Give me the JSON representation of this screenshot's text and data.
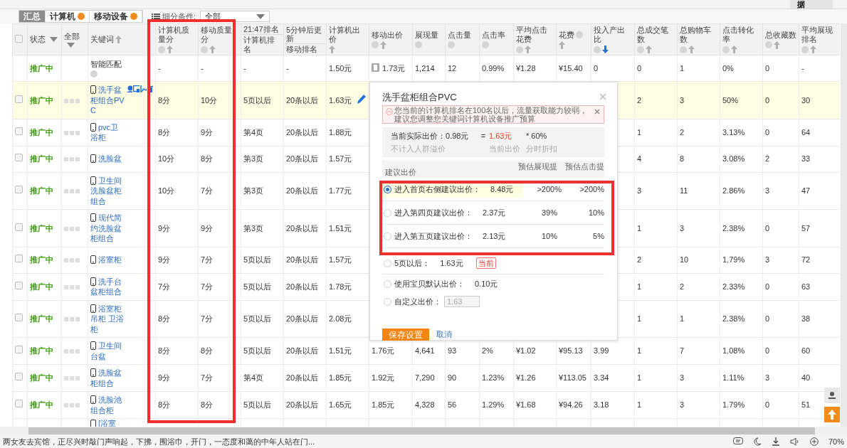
{
  "top_button": "据",
  "view_tabs": [
    {
      "label": "汇总",
      "selected": true,
      "help": false
    },
    {
      "label": "计算机",
      "selected": false,
      "help": true
    },
    {
      "label": "移动设备",
      "selected": false,
      "help": true
    }
  ],
  "filter": {
    "label": "细分条件:",
    "value": "全部"
  },
  "table": {
    "select_all": {
      "checked": false
    },
    "columns": [
      {
        "label": "状态",
        "filter": true
      },
      {
        "label": "全部",
        "filter": true
      },
      {
        "label": "关键词",
        "sortable": true,
        "sort_active": false
      },
      {
        "label": "计算机质量分",
        "help": true,
        "sortable": true,
        "sort_active": false
      },
      {
        "label": "移动质量分",
        "help": true,
        "sortable": true,
        "sort_active": false
      },
      {
        "top": "21:47排名",
        "label": "计算机排名"
      },
      {
        "top": "5分钟后更新",
        "label": "移动排名"
      },
      {
        "label": "计算机出价",
        "sortable": true,
        "sort_active": false
      },
      {
        "label": "移动出价",
        "help": true,
        "sortable": true,
        "sort_active": false
      },
      {
        "label": "展现量",
        "help": true
      },
      {
        "label": "点击量",
        "help": true
      },
      {
        "label": "点击率",
        "help": true
      },
      {
        "label": "平均点击花费",
        "help": true,
        "sortable": true,
        "sort_active": false
      },
      {
        "label": "花费",
        "help": true,
        "sortable": true,
        "sort_active": false
      },
      {
        "label": "投入产出比",
        "help": true,
        "sortable": true,
        "sort_active": true
      },
      {
        "label": "总成交笔数",
        "help": true,
        "sortable": true,
        "sort_active": false
      },
      {
        "label": "总购物车数",
        "help": true,
        "sortable": true,
        "sort_active": false
      },
      {
        "label": "点击转化率",
        "help": true,
        "sortable": true,
        "sort_active": false
      },
      {
        "label": "总收藏数",
        "help": true,
        "sortable": true,
        "sort_active": false
      },
      {
        "label": "平均展现排名",
        "help": true,
        "sortable": true,
        "sort_active": false
      }
    ],
    "rows": [
      {
        "kind": "smart",
        "selected": false,
        "status": "推广中",
        "keyword": "智能匹配",
        "cells": [
          "-",
          "-",
          "-",
          "-",
          "1.50元",
          "1.73元",
          "1,214",
          "12",
          "0.99%",
          "¥1.28",
          "¥15.40",
          "0",
          "0",
          "1",
          "0%",
          "0",
          "-"
        ]
      },
      {
        "kind": "keyword",
        "selected": true,
        "checked": false,
        "status": "推广中",
        "keyword": "洗手盆柜组合PVC",
        "cells": [
          "8分",
          "10分",
          "5页以后",
          "20条以后",
          "1.63元",
          null,
          null,
          null,
          null,
          null,
          null,
          null,
          "2",
          "3",
          "50%",
          "0",
          "30"
        ]
      },
      {
        "kind": "keyword",
        "selected": false,
        "checked": false,
        "status": "推广中",
        "keyword": "pvc卫浴柜",
        "cells": [
          "8分",
          "9分",
          "第4页",
          "20条以后",
          "1.88元",
          null,
          null,
          null,
          null,
          null,
          null,
          null,
          "1",
          "2",
          "3.13%",
          "0",
          "64"
        ]
      },
      {
        "kind": "keyword",
        "selected": false,
        "checked": false,
        "status": "推广中",
        "keyword": "洗脸盆",
        "cells": [
          "10分",
          "8分",
          "第3页",
          "20条以后",
          "1.57元",
          null,
          null,
          null,
          null,
          null,
          null,
          null,
          "4",
          "8",
          "3.08%",
          "2",
          "33"
        ]
      },
      {
        "kind": "keyword",
        "selected": false,
        "checked": false,
        "status": "推广中",
        "keyword": "卫生间洗脸盆柜组合",
        "cells": [
          "10分",
          "7分",
          "第3页",
          "20条以后",
          "1.77元",
          null,
          null,
          null,
          null,
          null,
          null,
          null,
          "3",
          "11",
          "2.86%",
          "3",
          "47"
        ]
      },
      {
        "kind": "keyword",
        "selected": false,
        "checked": false,
        "status": "推广中",
        "keyword": "现代简约洗脸盆柜组合",
        "cells": [
          "9分",
          "9分",
          "第3页",
          "20条以后",
          "1.51元",
          null,
          null,
          null,
          null,
          null,
          null,
          null,
          "1",
          "3",
          "2.38%",
          "0",
          "57"
        ]
      },
      {
        "kind": "keyword",
        "selected": false,
        "checked": false,
        "status": "推广中",
        "keyword": "浴室柜",
        "cells": [
          "9分",
          "7分",
          "5页以后",
          "20条以后",
          "1.57元",
          null,
          null,
          null,
          null,
          null,
          null,
          null,
          "2",
          "10",
          "1.79%",
          "3",
          "72"
        ]
      },
      {
        "kind": "keyword",
        "selected": false,
        "checked": false,
        "status": "推广中",
        "keyword": "洗手台盆柜组合",
        "cells": [
          "7分",
          "7分",
          "5页以后",
          "20条以后",
          "1.78元",
          null,
          null,
          null,
          null,
          null,
          null,
          null,
          "1",
          "2",
          "2.33%",
          "0",
          "63"
        ]
      },
      {
        "kind": "keyword",
        "selected": false,
        "checked": false,
        "status": "推广中",
        "keyword": "浴室柜吊柜 卫浴柜",
        "cells": [
          "8分",
          "7分",
          "5页以后",
          "20条以后",
          "2.08元",
          null,
          null,
          null,
          null,
          null,
          null,
          null,
          "1",
          "1",
          "2.38%",
          "0",
          "38"
        ]
      },
      {
        "kind": "keyword",
        "selected": false,
        "checked": false,
        "status": "推广中",
        "keyword": "卫生间台盆",
        "cells": [
          "8分",
          "8分",
          "5页以后",
          "20条以后",
          "1.51元",
          "1.76元",
          "4,641",
          "93",
          "2%",
          "¥1.02",
          "¥95.13",
          "3.99",
          "1",
          "7",
          "1.08%",
          "0",
          "60"
        ]
      },
      {
        "kind": "keyword",
        "selected": false,
        "checked": false,
        "status": "推广中",
        "keyword": "洗脸盆柜组合",
        "cells": [
          "9分",
          "7分",
          "第4页",
          "20条以后",
          "1.85元",
          "1.92元",
          "7,290",
          "90",
          "1.23%",
          "¥1.26",
          "¥113.05",
          "3.34",
          "1",
          "3",
          "1.11%",
          "3",
          "40"
        ]
      },
      {
        "kind": "keyword",
        "selected": false,
        "checked": false,
        "status": "推广中",
        "keyword": "洗脸池组合柜",
        "cells": [
          "8分",
          "8分",
          "5页以后",
          "20条以后",
          "1.65元",
          "1.85元",
          "4,328",
          "56",
          "1.29%",
          "¥1.68",
          "¥94.26",
          "3.18",
          "1",
          "3",
          "1.79%",
          "0",
          "51"
        ]
      },
      {
        "kind": "partial",
        "keyword": "[浴室"
      }
    ]
  },
  "bid_popup": {
    "title": "洗手盆柜组合PVC",
    "warning": "您当前的计算机排名在100名以后，流量获取能力较弱，建议您调整您关键词计算机设备推广预算",
    "formula": {
      "actual": "当前实际出价：0.98元",
      "equals": "=",
      "current": "1.63元",
      "discount": "* 60%",
      "actual_note": "不计入人群溢价",
      "current_note": "当前出价",
      "discount_note": "分时折扣"
    },
    "header": {
      "label": "建议出价",
      "impressions": "预估展现提",
      "clicks": "预估点击提"
    },
    "options": [
      {
        "kind": "suggested",
        "selected": true,
        "label": "进入首页右侧建议出价：",
        "price": "8.48元",
        "impressions": ">200%",
        "clicks": ">200%"
      },
      {
        "kind": "suggested",
        "selected": false,
        "label": "进入第四页建议出价：",
        "price": "2.37元",
        "impressions": "39%",
        "clicks": "10%"
      },
      {
        "kind": "suggested",
        "selected": false,
        "label": "进入第五页建议出价：",
        "price": "2.13元",
        "impressions": "10%",
        "clicks": "5%"
      },
      {
        "kind": "current",
        "selected": false,
        "label": "5页以后：",
        "price": "1.63元",
        "badge": "当前"
      },
      {
        "kind": "default",
        "selected": false,
        "label": "使用宝贝默认出价：",
        "price": "0.10元"
      },
      {
        "kind": "custom",
        "selected": false,
        "label": "自定义出价：",
        "value": "1.63",
        "disabled": true
      }
    ],
    "save": "保存设置",
    "cancel": "取消"
  },
  "status_bar": {
    "text": "两女友去宾馆，正尽兴时敲门声响起，下拂，围浴巾，开门，一态度和蔼的中年人站在门...",
    "zoom": "70%"
  }
}
